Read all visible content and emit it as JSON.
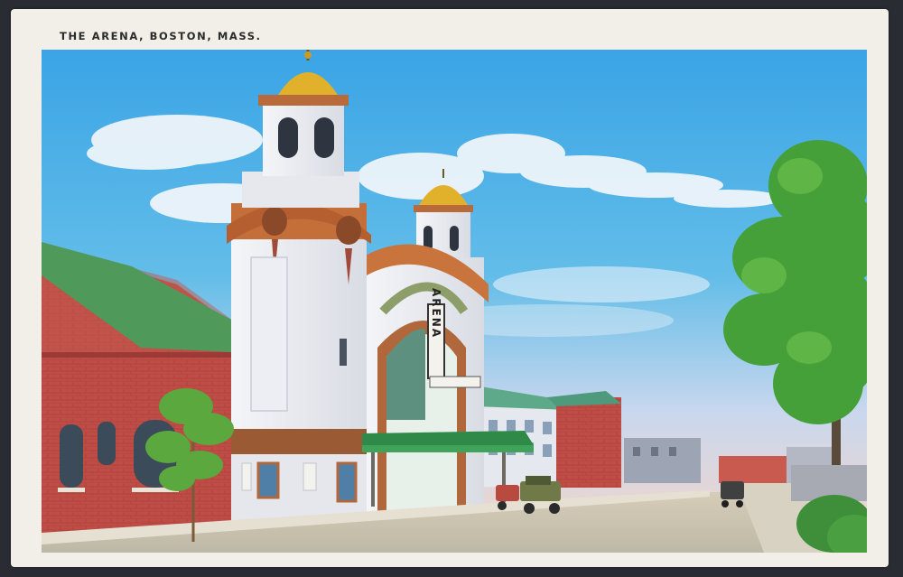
{
  "postcard": {
    "caption": "THE ARENA, BOSTON, MASS.",
    "marquee_sign": "ARENA",
    "colors": {
      "border": "#f1efe8",
      "sky_top": "#3da7e6",
      "sky_bottom": "#f6d7c9",
      "brick": "#c0504a",
      "roof_green": "#4e9a5a",
      "facade": "#e8eaef",
      "dome_gold": "#e0b02a",
      "tree": "#3f9a3a",
      "street": "#c9c4b3"
    }
  }
}
